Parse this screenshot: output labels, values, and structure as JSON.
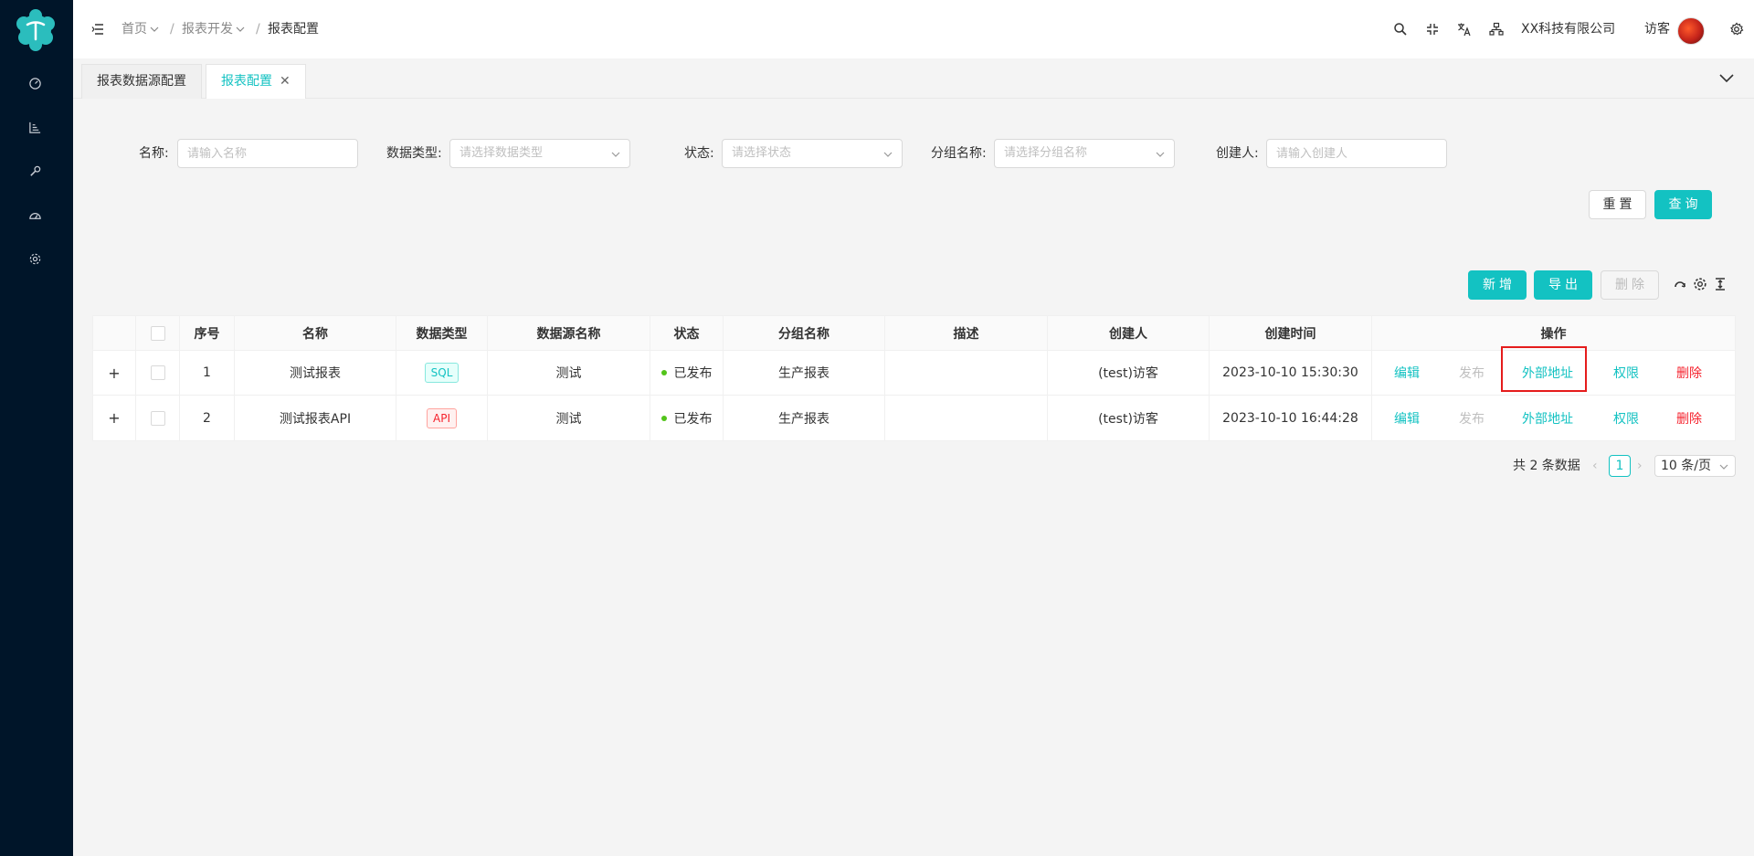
{
  "header": {
    "breadcrumb": [
      "首页",
      "报表开发",
      "报表配置"
    ],
    "company": "XX科技有限公司",
    "user": "访客"
  },
  "tabs": [
    {
      "label": "报表数据源配置"
    },
    {
      "label": "报表配置"
    }
  ],
  "filters": {
    "name": {
      "label": "名称:",
      "placeholder": "请输入名称"
    },
    "data_type": {
      "label": "数据类型:",
      "placeholder": "请选择数据类型"
    },
    "status": {
      "label": "状态:",
      "placeholder": "请选择状态"
    },
    "group_name": {
      "label": "分组名称:",
      "placeholder": "请选择分组名称"
    },
    "creator": {
      "label": "创建人:",
      "placeholder": "请输入创建人"
    }
  },
  "buttons": {
    "reset": "重置",
    "query": "查询",
    "add": "新增",
    "export": "导出",
    "delete": "删除"
  },
  "table": {
    "columns": [
      "序号",
      "名称",
      "数据类型",
      "数据源名称",
      "状态",
      "分组名称",
      "描述",
      "创建人",
      "创建时间",
      "操作"
    ],
    "rows": [
      {
        "expand": "+",
        "index": "1",
        "name": "测试报表",
        "type": "SQL",
        "source": "测试",
        "status": "已发布",
        "group": "生产报表",
        "desc": "",
        "creator": "(test)访客",
        "created": "2023-10-10 15:30:30"
      },
      {
        "expand": "+",
        "index": "2",
        "name": "测试报表API",
        "type": "API",
        "source": "测试",
        "status": "已发布",
        "group": "生产报表",
        "desc": "",
        "creator": "(test)访客",
        "created": "2023-10-10 16:44:28"
      }
    ],
    "actions": {
      "edit": "编辑",
      "publish": "发布",
      "external": "外部地址",
      "permission": "权限",
      "delete": "删除"
    }
  },
  "pagination": {
    "total": "共 2 条数据",
    "current": "1",
    "page_size": "10 条/页"
  },
  "colors": {
    "sidebar": "#001529",
    "primary": "#13c2c2",
    "danger": "#f5222d",
    "highlight": "#e51c1c"
  }
}
